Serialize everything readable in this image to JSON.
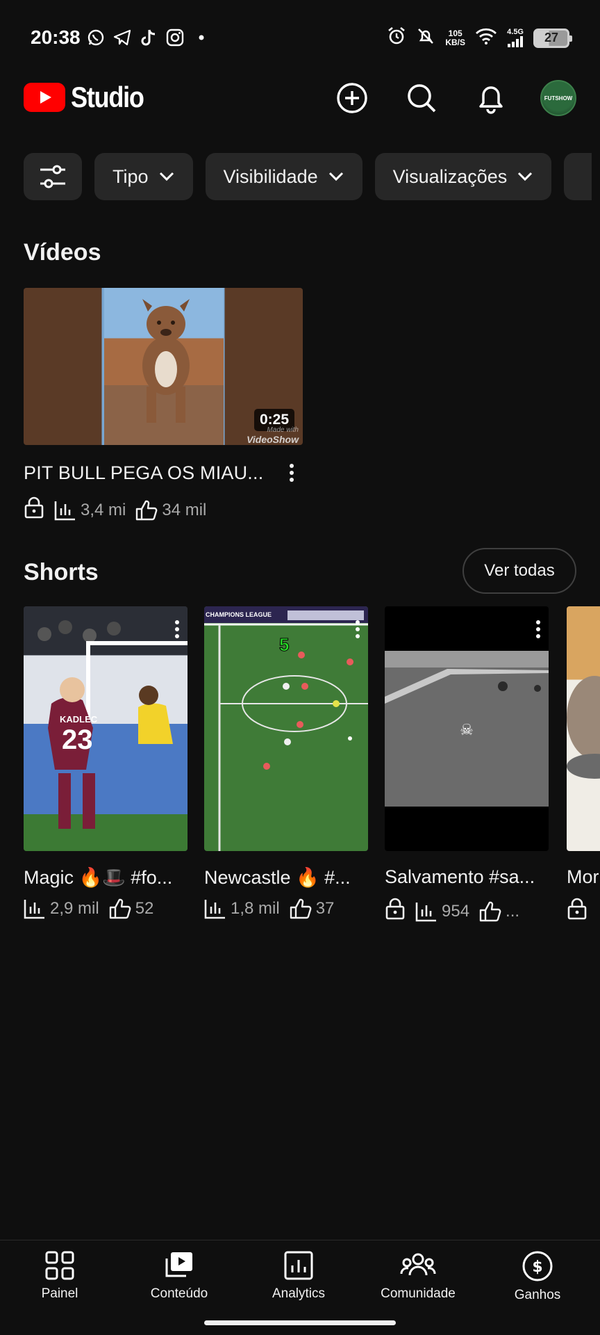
{
  "status_bar": {
    "time": "20:38",
    "left_icons": [
      "whatsapp-icon",
      "telegram-icon",
      "tiktok-icon",
      "instagram-icon",
      "dot-icon"
    ],
    "net_speed_value": "105",
    "net_speed_unit": "KB/S",
    "network_type": "4.5G",
    "battery": "27"
  },
  "header": {
    "app_name": "Studio",
    "actions": [
      "create-icon",
      "search-icon",
      "notifications-icon"
    ],
    "avatar_text": "FUTSHOW"
  },
  "filters": {
    "chips": [
      {
        "label": "Tipo"
      },
      {
        "label": "Visibilidade"
      },
      {
        "label": "Visualizações"
      }
    ]
  },
  "videos": {
    "section_title": "Vídeos",
    "items": [
      {
        "title": "PIT BULL PEGA OS MIAU...",
        "duration": "0:25",
        "watermark_line1": "Made with",
        "watermark_line2": "VideoShow",
        "visibility": "private",
        "views": "3,4 mi",
        "likes": "34 mil"
      }
    ]
  },
  "shorts": {
    "section_title": "Shorts",
    "see_all_label": "Ver todas",
    "items": [
      {
        "title": "Magic 🔥🎩 #fo...",
        "views": "2,9 mil",
        "likes": "52",
        "private": false,
        "jersey_name": "KADLEC",
        "jersey_number": "23"
      },
      {
        "title": "Newcastle 🔥 #...",
        "views": "1,8 mil",
        "likes": "37",
        "private": false,
        "overlay_number": "5",
        "banner_text": "CHAMPIONS LEAGUE"
      },
      {
        "title": "Salvamento #sa...",
        "views": "954",
        "likes": "...",
        "private": true
      },
      {
        "title": "Mor",
        "views": "",
        "likes": "",
        "private": true
      }
    ]
  },
  "bottom_nav": {
    "items": [
      {
        "label": "Painel",
        "icon": "dashboard-icon"
      },
      {
        "label": "Conteúdo",
        "icon": "content-icon"
      },
      {
        "label": "Analytics",
        "icon": "analytics-icon"
      },
      {
        "label": "Comunidade",
        "icon": "community-icon"
      },
      {
        "label": "Ganhos",
        "icon": "earnings-icon"
      }
    ]
  },
  "colors": {
    "background": "#0f0f0f",
    "chip_bg": "#272727",
    "brand_red": "#ff0000",
    "text_primary": "#f1f1f1",
    "text_secondary": "#aaaaaa"
  }
}
